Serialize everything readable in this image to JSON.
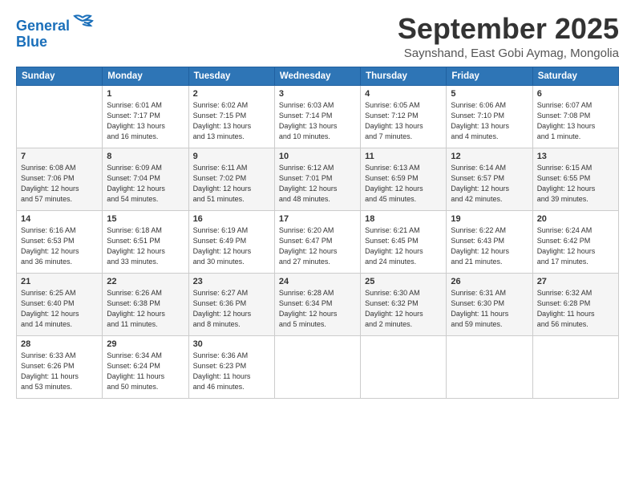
{
  "logo": {
    "line1": "General",
    "line2": "Blue"
  },
  "title": "September 2025",
  "subtitle": "Saynshand, East Gobi Aymag, Mongolia",
  "days_of_week": [
    "Sunday",
    "Monday",
    "Tuesday",
    "Wednesday",
    "Thursday",
    "Friday",
    "Saturday"
  ],
  "weeks": [
    [
      {
        "day": "",
        "info": ""
      },
      {
        "day": "1",
        "info": "Sunrise: 6:01 AM\nSunset: 7:17 PM\nDaylight: 13 hours\nand 16 minutes."
      },
      {
        "day": "2",
        "info": "Sunrise: 6:02 AM\nSunset: 7:15 PM\nDaylight: 13 hours\nand 13 minutes."
      },
      {
        "day": "3",
        "info": "Sunrise: 6:03 AM\nSunset: 7:14 PM\nDaylight: 13 hours\nand 10 minutes."
      },
      {
        "day": "4",
        "info": "Sunrise: 6:05 AM\nSunset: 7:12 PM\nDaylight: 13 hours\nand 7 minutes."
      },
      {
        "day": "5",
        "info": "Sunrise: 6:06 AM\nSunset: 7:10 PM\nDaylight: 13 hours\nand 4 minutes."
      },
      {
        "day": "6",
        "info": "Sunrise: 6:07 AM\nSunset: 7:08 PM\nDaylight: 13 hours\nand 1 minute."
      }
    ],
    [
      {
        "day": "7",
        "info": "Sunrise: 6:08 AM\nSunset: 7:06 PM\nDaylight: 12 hours\nand 57 minutes."
      },
      {
        "day": "8",
        "info": "Sunrise: 6:09 AM\nSunset: 7:04 PM\nDaylight: 12 hours\nand 54 minutes."
      },
      {
        "day": "9",
        "info": "Sunrise: 6:11 AM\nSunset: 7:02 PM\nDaylight: 12 hours\nand 51 minutes."
      },
      {
        "day": "10",
        "info": "Sunrise: 6:12 AM\nSunset: 7:01 PM\nDaylight: 12 hours\nand 48 minutes."
      },
      {
        "day": "11",
        "info": "Sunrise: 6:13 AM\nSunset: 6:59 PM\nDaylight: 12 hours\nand 45 minutes."
      },
      {
        "day": "12",
        "info": "Sunrise: 6:14 AM\nSunset: 6:57 PM\nDaylight: 12 hours\nand 42 minutes."
      },
      {
        "day": "13",
        "info": "Sunrise: 6:15 AM\nSunset: 6:55 PM\nDaylight: 12 hours\nand 39 minutes."
      }
    ],
    [
      {
        "day": "14",
        "info": "Sunrise: 6:16 AM\nSunset: 6:53 PM\nDaylight: 12 hours\nand 36 minutes."
      },
      {
        "day": "15",
        "info": "Sunrise: 6:18 AM\nSunset: 6:51 PM\nDaylight: 12 hours\nand 33 minutes."
      },
      {
        "day": "16",
        "info": "Sunrise: 6:19 AM\nSunset: 6:49 PM\nDaylight: 12 hours\nand 30 minutes."
      },
      {
        "day": "17",
        "info": "Sunrise: 6:20 AM\nSunset: 6:47 PM\nDaylight: 12 hours\nand 27 minutes."
      },
      {
        "day": "18",
        "info": "Sunrise: 6:21 AM\nSunset: 6:45 PM\nDaylight: 12 hours\nand 24 minutes."
      },
      {
        "day": "19",
        "info": "Sunrise: 6:22 AM\nSunset: 6:43 PM\nDaylight: 12 hours\nand 21 minutes."
      },
      {
        "day": "20",
        "info": "Sunrise: 6:24 AM\nSunset: 6:42 PM\nDaylight: 12 hours\nand 17 minutes."
      }
    ],
    [
      {
        "day": "21",
        "info": "Sunrise: 6:25 AM\nSunset: 6:40 PM\nDaylight: 12 hours\nand 14 minutes."
      },
      {
        "day": "22",
        "info": "Sunrise: 6:26 AM\nSunset: 6:38 PM\nDaylight: 12 hours\nand 11 minutes."
      },
      {
        "day": "23",
        "info": "Sunrise: 6:27 AM\nSunset: 6:36 PM\nDaylight: 12 hours\nand 8 minutes."
      },
      {
        "day": "24",
        "info": "Sunrise: 6:28 AM\nSunset: 6:34 PM\nDaylight: 12 hours\nand 5 minutes."
      },
      {
        "day": "25",
        "info": "Sunrise: 6:30 AM\nSunset: 6:32 PM\nDaylight: 12 hours\nand 2 minutes."
      },
      {
        "day": "26",
        "info": "Sunrise: 6:31 AM\nSunset: 6:30 PM\nDaylight: 11 hours\nand 59 minutes."
      },
      {
        "day": "27",
        "info": "Sunrise: 6:32 AM\nSunset: 6:28 PM\nDaylight: 11 hours\nand 56 minutes."
      }
    ],
    [
      {
        "day": "28",
        "info": "Sunrise: 6:33 AM\nSunset: 6:26 PM\nDaylight: 11 hours\nand 53 minutes."
      },
      {
        "day": "29",
        "info": "Sunrise: 6:34 AM\nSunset: 6:24 PM\nDaylight: 11 hours\nand 50 minutes."
      },
      {
        "day": "30",
        "info": "Sunrise: 6:36 AM\nSunset: 6:23 PM\nDaylight: 11 hours\nand 46 minutes."
      },
      {
        "day": "",
        "info": ""
      },
      {
        "day": "",
        "info": ""
      },
      {
        "day": "",
        "info": ""
      },
      {
        "day": "",
        "info": ""
      }
    ]
  ]
}
